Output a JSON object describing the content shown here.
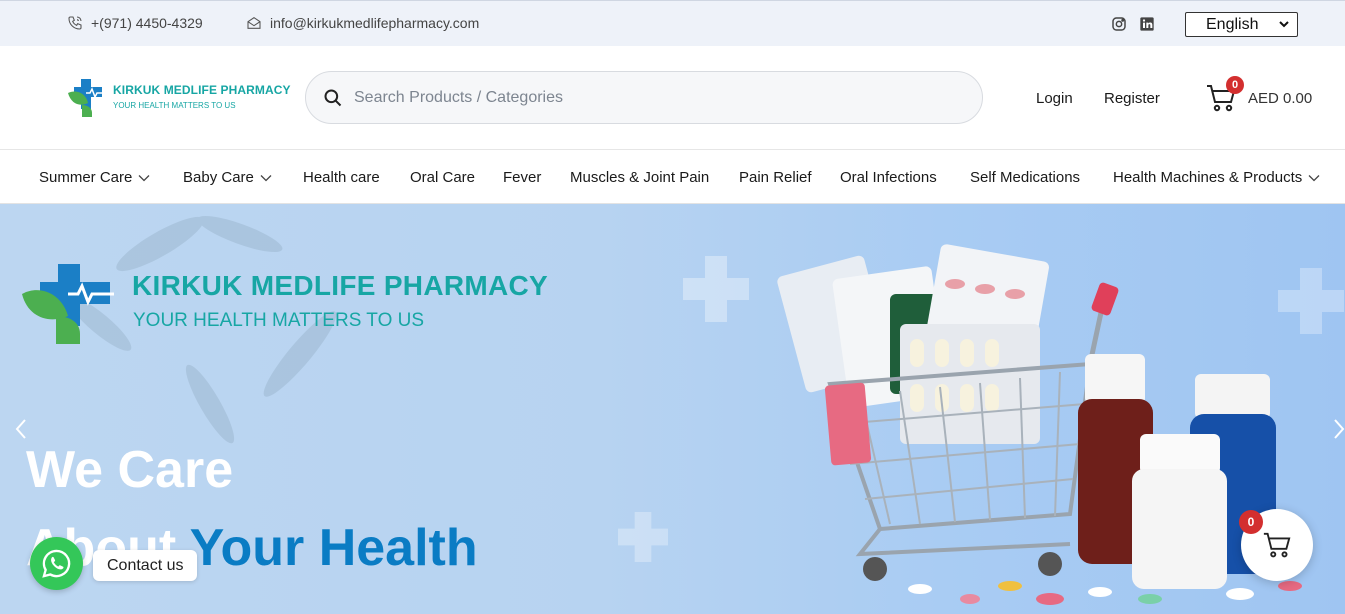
{
  "topbar": {
    "phone": "+(971) 4450-4329",
    "email": "info@kirkukmedlifepharmacy.com",
    "social_icons": [
      "instagram-icon",
      "linkedin-icon"
    ],
    "language": "English"
  },
  "header": {
    "logo_name": "KIRKUK MEDLIFE PHARMACY",
    "logo_tagline": "YOUR HEALTH MATTERS TO US",
    "search_placeholder": "Search Products / Categories",
    "login": "Login",
    "register": "Register",
    "cart_count": "0",
    "cart_total": "AED 0.00"
  },
  "nav": {
    "items": [
      {
        "label": "Summer Care",
        "dropdown": true
      },
      {
        "label": "Baby Care",
        "dropdown": true
      },
      {
        "label": "Health care",
        "dropdown": false
      },
      {
        "label": "Oral Care",
        "dropdown": false
      },
      {
        "label": "Fever",
        "dropdown": false
      },
      {
        "label": "Muscles & Joint Pain",
        "dropdown": false
      },
      {
        "label": "Pain Relief",
        "dropdown": false
      },
      {
        "label": "Oral Infections",
        "dropdown": false
      },
      {
        "label": "Self Medications",
        "dropdown": false
      },
      {
        "label": "Health Machines & Products",
        "dropdown": true
      }
    ]
  },
  "hero": {
    "brand_name": "KIRKUK MEDLIFE PHARMACY",
    "brand_tagline": "YOUR HEALTH MATTERS TO US",
    "line1": "We Care",
    "line2_white": "About ",
    "line2_blue": "Your Health"
  },
  "floating": {
    "contact_us": "Contact us",
    "cart_count": "0"
  },
  "colors": {
    "brand_teal": "#17a6a4",
    "brand_green": "#4caf50",
    "brand_blue": "#0a7cc4",
    "badge_red": "#d32f2f",
    "whatsapp_green": "#34c759"
  }
}
